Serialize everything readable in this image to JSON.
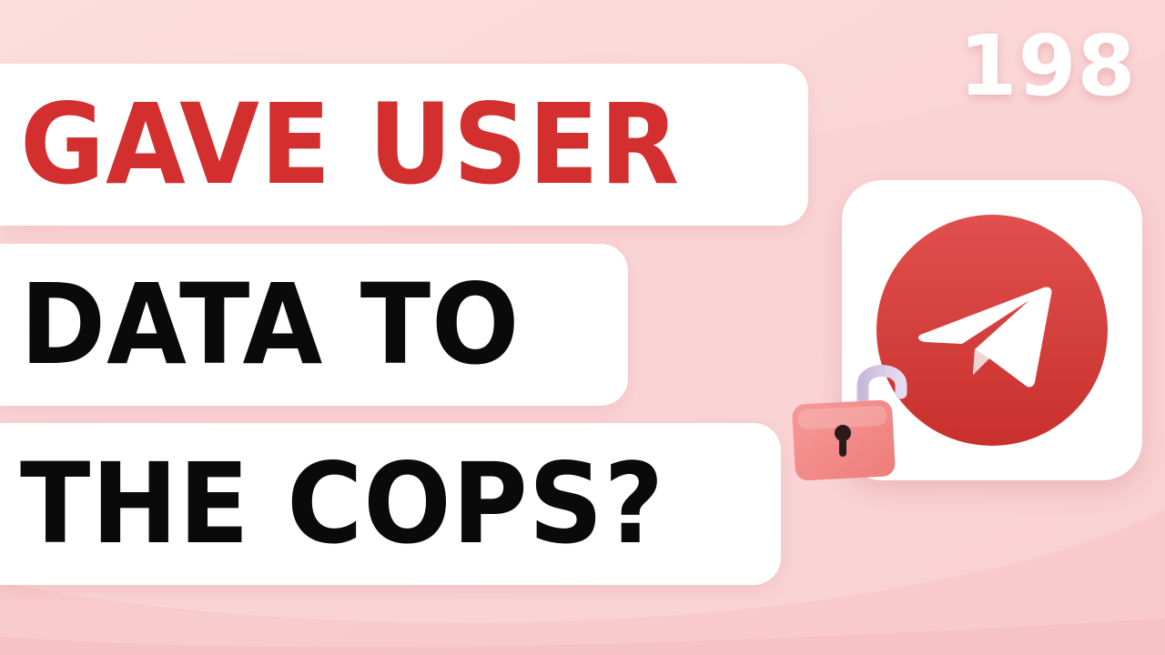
{
  "headline": {
    "line1": "GAVE USER",
    "line2": "DATA TO",
    "line3": "THE COPS?"
  },
  "episode_number": "198",
  "icons": {
    "app": "telegram-paper-plane-icon",
    "lock": "open-padlock-icon"
  },
  "colors": {
    "background": "#fbd6d6",
    "accent_red": "#d32f2f",
    "headline_black": "#0a0a0a",
    "pill_white": "#ffffff",
    "lock_pink": "#f28b8b"
  }
}
